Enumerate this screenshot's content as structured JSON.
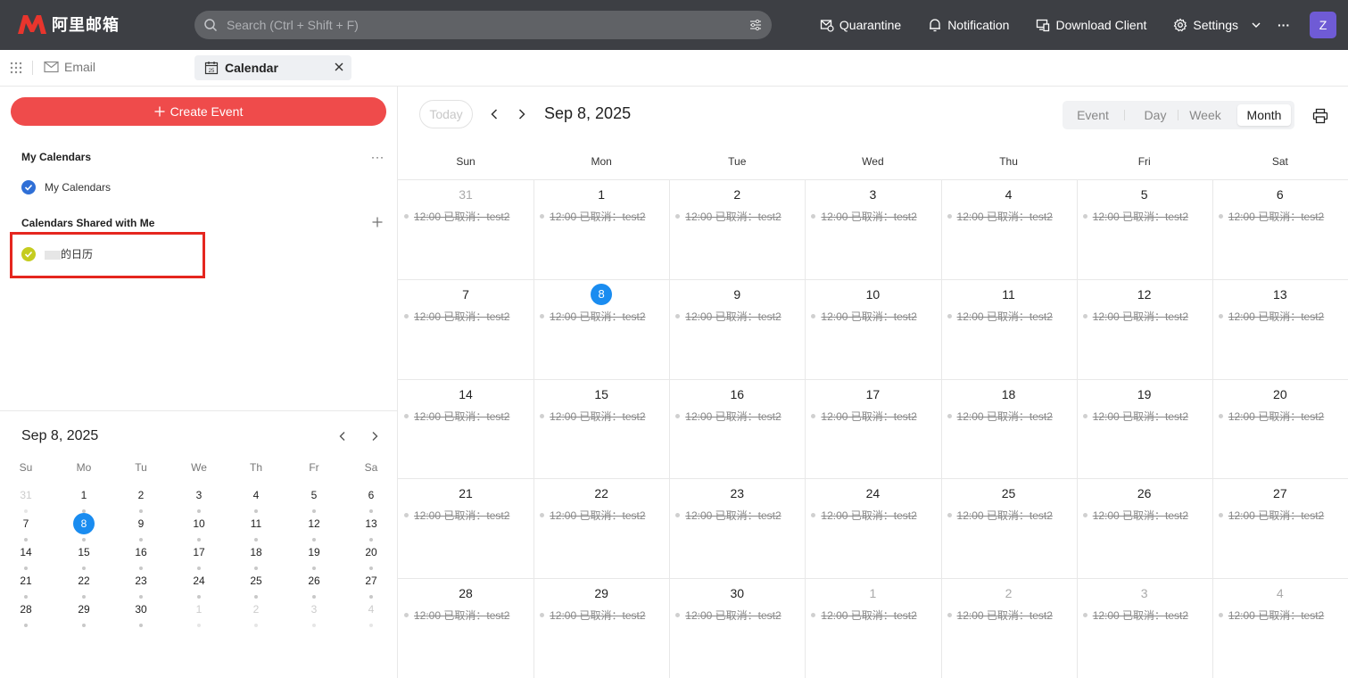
{
  "app": {
    "brand": "阿里邮箱",
    "search_placeholder": "Search (Ctrl + Shift + F)",
    "actions": [
      "Quarantine",
      "Notification",
      "Download Client",
      "Settings"
    ],
    "more": "···",
    "avatar": "Z"
  },
  "tabs": {
    "email": "Email",
    "calendar": "Calendar",
    "calendar_icon_day": "25"
  },
  "sidebar": {
    "create_event": "Create Event",
    "my_calendars_title": "My Calendars",
    "my_calendars_more": "···",
    "my_calendar_item": "My Calendars",
    "shared_title": "Calendars Shared with Me",
    "shared_item_suffix": "的日历"
  },
  "mini_calendar": {
    "title": "Sep 8, 2025",
    "dow": [
      "Su",
      "Mo",
      "Tu",
      "We",
      "Th",
      "Fr",
      "Sa"
    ],
    "weeks": [
      [
        "31",
        "1",
        "2",
        "3",
        "4",
        "5",
        "6"
      ],
      [
        "7",
        "8",
        "9",
        "10",
        "11",
        "12",
        "13"
      ],
      [
        "14",
        "15",
        "16",
        "17",
        "18",
        "19",
        "20"
      ],
      [
        "21",
        "22",
        "23",
        "24",
        "25",
        "26",
        "27"
      ],
      [
        "28",
        "29",
        "30",
        "1",
        "2",
        "3",
        "4"
      ]
    ],
    "today": "8"
  },
  "main": {
    "today_button": "Today",
    "title": "Sep 8, 2025",
    "views": [
      "Event",
      "Day",
      "Week",
      "Month"
    ],
    "active_view": "Month",
    "dow": [
      "Sun",
      "Mon",
      "Tue",
      "Wed",
      "Thu",
      "Fri",
      "Sat"
    ],
    "weeks": [
      [
        "31",
        "1",
        "2",
        "3",
        "4",
        "5",
        "6"
      ],
      [
        "7",
        "8",
        "9",
        "10",
        "11",
        "12",
        "13"
      ],
      [
        "14",
        "15",
        "16",
        "17",
        "18",
        "19",
        "20"
      ],
      [
        "21",
        "22",
        "23",
        "24",
        "25",
        "26",
        "27"
      ],
      [
        "28",
        "29",
        "30",
        "1",
        "2",
        "3",
        "4"
      ]
    ],
    "today": "8",
    "event_text": "12:00 已取消：test2"
  }
}
